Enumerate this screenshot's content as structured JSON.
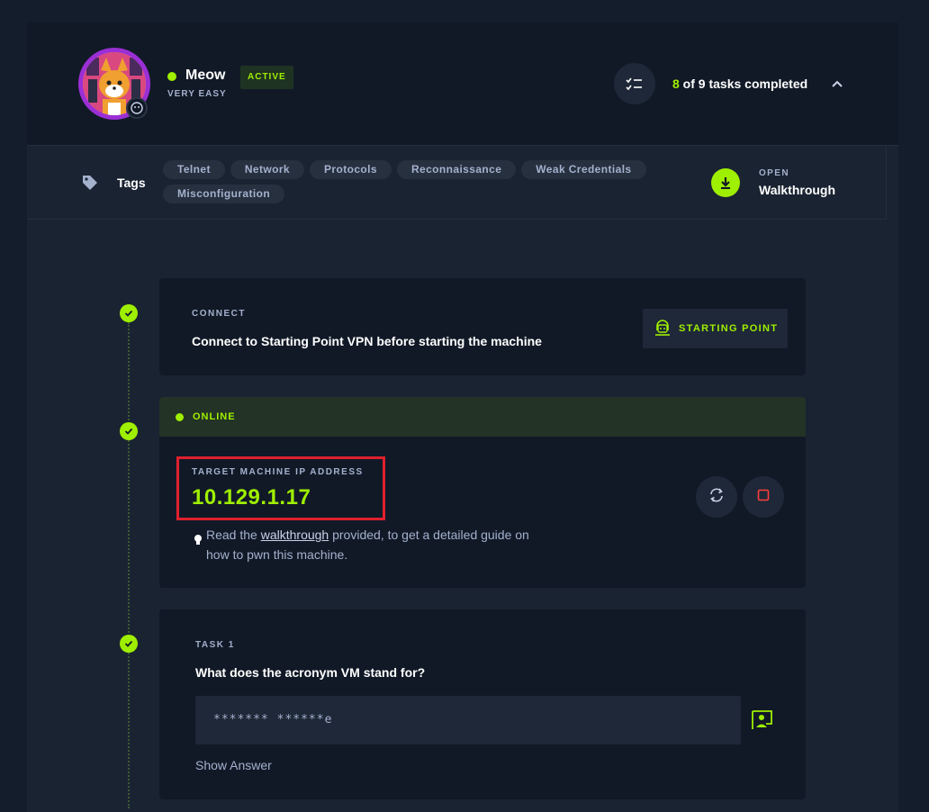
{
  "machine": {
    "name": "Meow",
    "difficulty": "VERY EASY",
    "status_badge": "ACTIVE",
    "tasks_completed": "8",
    "tasks_rest": " of 9 tasks completed"
  },
  "tags": {
    "label": "Tags",
    "items": [
      "Telnet",
      "Network",
      "Protocols",
      "Reconnaissance",
      "Weak Credentials",
      "Misconfiguration"
    ],
    "open_label": "OPEN",
    "walkthrough_label": "Walkthrough"
  },
  "connect": {
    "label": "CONNECT",
    "title": "Connect to Starting Point VPN before starting the machine",
    "button_label": "STARTING POINT"
  },
  "target": {
    "status": "ONLINE",
    "ip_label": "TARGET MACHINE IP ADDRESS",
    "ip_value": "10.129.1.17",
    "tip_before": "Read the ",
    "tip_link": "walkthrough",
    "tip_after": " provided, to get a detailed guide on how to pwn this machine."
  },
  "task1": {
    "label": "TASK 1",
    "question": "What does the acronym VM stand for?",
    "answer_mask": "******* ******e",
    "show_answer": "Show Answer"
  },
  "colors": {
    "accent": "#9fef00",
    "background": "#141d2b",
    "card": "#111927",
    "text_muted": "#a4b1cd",
    "highlight": "#e0202e"
  }
}
